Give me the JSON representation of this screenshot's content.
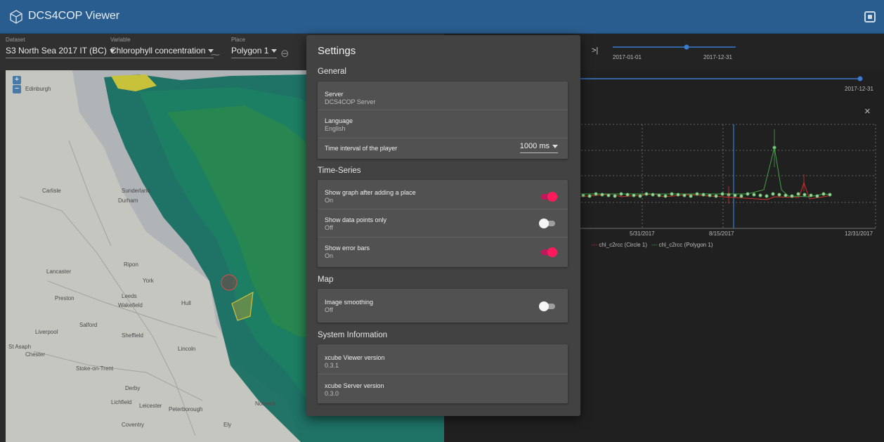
{
  "app": {
    "title": "DCS4COP Viewer"
  },
  "toolbar": {
    "dataset": {
      "label": "Dataset",
      "value": "S3 North Sea 2017 IT (BC)"
    },
    "variable": {
      "label": "Variable",
      "value": "Chlorophyll concentration"
    },
    "place": {
      "label": "Place",
      "value": "Polygon 1"
    }
  },
  "timeline": {
    "start_label": "2017-01-01",
    "end_label": "2017-12-31",
    "current_label": "2017-12-31"
  },
  "chart_data": {
    "type": "line",
    "x_ticks": [
      "5/31/2017",
      "8/15/2017",
      "12/31/2017"
    ],
    "series": [
      {
        "name": "chl_c2rcc (Circle 1)",
        "color": "#d32f2f"
      },
      {
        "name": "chl_c2rcc (Polygon 1)",
        "color": "#43a047"
      }
    ]
  },
  "map": {
    "labels": [
      "Edinburgh",
      "Carlisle",
      "Sunderland",
      "Durham",
      "Lancaster",
      "Ripon",
      "York",
      "Preston",
      "Leeds",
      "Wakefield",
      "Hull",
      "Liverpool",
      "Salford",
      "Sheffield",
      "St Asaph",
      "Chester",
      "Lincoln",
      "Stoke-on-Trent",
      "Derby",
      "Lichfield",
      "Leicester",
      "Peterborough",
      "Norwich",
      "Coventry",
      "Ely"
    ]
  },
  "settings": {
    "title": "Settings",
    "general": {
      "title": "General",
      "server": {
        "label": "Server",
        "value": "DCS4COP Server"
      },
      "language": {
        "label": "Language",
        "value": "English"
      },
      "interval": {
        "label": "Time interval of the player",
        "value": "1000 ms"
      }
    },
    "timeseries": {
      "title": "Time-Series",
      "show_graph": {
        "label": "Show graph after adding a place",
        "value": "On"
      },
      "points_only": {
        "label": "Show data points only",
        "value": "Off"
      },
      "error_bars": {
        "label": "Show error bars",
        "value": "On"
      }
    },
    "map": {
      "title": "Map",
      "smoothing": {
        "label": "Image smoothing",
        "value": "Off"
      }
    },
    "system": {
      "title": "System Information",
      "viewer": {
        "label": "xcube Viewer version",
        "value": "0.3.1"
      },
      "server": {
        "label": "xcube Server version",
        "value": "0.3.0"
      }
    }
  }
}
